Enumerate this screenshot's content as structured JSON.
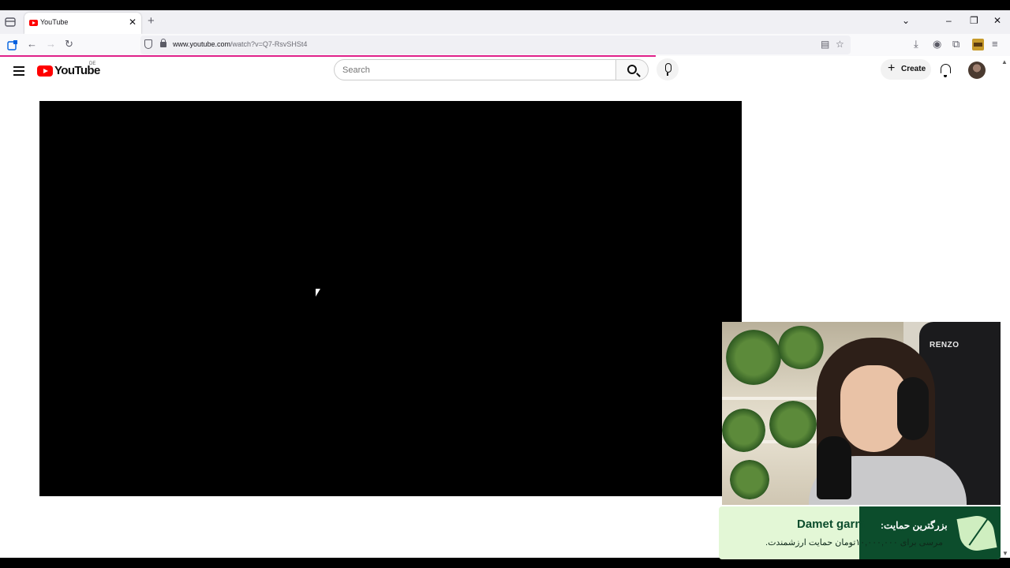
{
  "browser": {
    "tab_title": "YouTube",
    "url_domain": "www.youtube.com",
    "url_prefix": "",
    "url_path": "/watch?v=Q7-RsvSHSt4",
    "tab_close": "✕",
    "new_tab": "+",
    "window_controls": {
      "tab_list": "⌄",
      "minimize": "–",
      "restore": "❐",
      "close": "✕"
    },
    "nav_icons": {
      "back": "←",
      "forward": "→",
      "reload": "↻"
    },
    "toolbar_icons": {
      "reader": "▤",
      "bookmark": "☆",
      "downloads": "⤓",
      "account": "◉",
      "extensions": "⧉",
      "menu": "≡"
    },
    "accent_color": "#e0218a"
  },
  "youtube": {
    "logo_text": "YouTube",
    "country_code": "DE",
    "search_placeholder": "Search",
    "create_label": "Create",
    "create_plus": "+",
    "brand_color": "#ff0000"
  },
  "overlay": {
    "cam_brand": "RENZO",
    "banner_title": "Damet garm",
    "banner_title_rtl": "بزرگترین حمایت:",
    "banner_sub_rtl": "مرسی برای ۱۰,۰۰۰,۰۰۰تومان حمایت ارزشمندت."
  }
}
